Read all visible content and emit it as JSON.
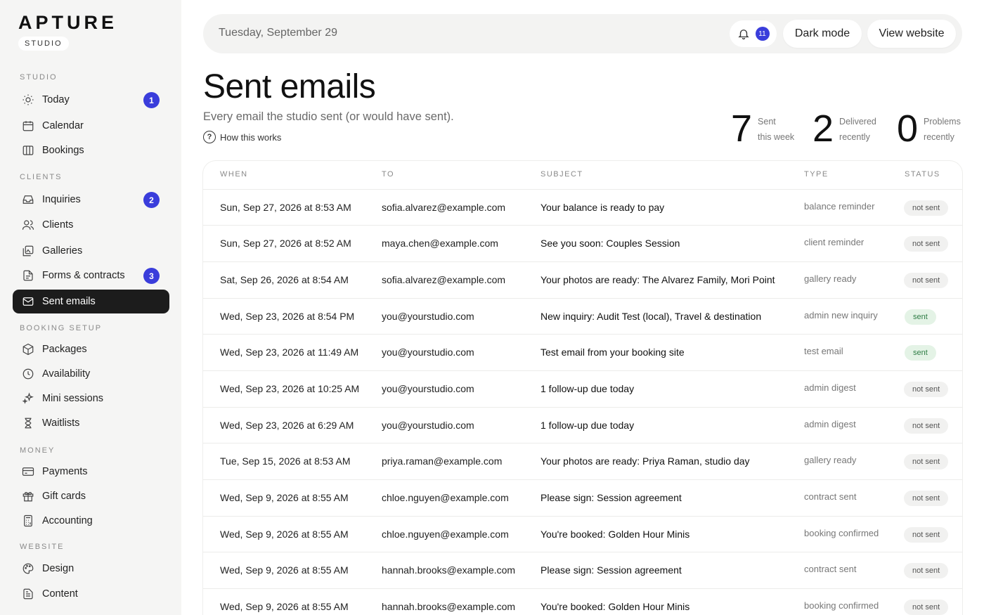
{
  "brand": {
    "wordmark": "APTURE",
    "badge": "STUDIO"
  },
  "sidebar": {
    "sections": [
      {
        "title": "STUDIO",
        "items": [
          {
            "label": "Today",
            "icon": "sun-icon",
            "badge": "1"
          },
          {
            "label": "Calendar",
            "icon": "calendar-icon"
          },
          {
            "label": "Bookings",
            "icon": "columns-icon"
          }
        ]
      },
      {
        "title": "CLIENTS",
        "items": [
          {
            "label": "Inquiries",
            "icon": "inbox-icon",
            "badge": "2"
          },
          {
            "label": "Clients",
            "icon": "users-icon"
          },
          {
            "label": "Galleries",
            "icon": "gallery-icon"
          },
          {
            "label": "Forms & contracts",
            "icon": "contract-icon",
            "badge": "3"
          },
          {
            "label": "Sent emails",
            "icon": "mail-icon",
            "active": true
          }
        ]
      },
      {
        "title": "BOOKING SETUP",
        "items": [
          {
            "label": "Packages",
            "icon": "package-icon"
          },
          {
            "label": "Availability",
            "icon": "clock-icon"
          },
          {
            "label": "Mini sessions",
            "icon": "sparkle-icon"
          },
          {
            "label": "Waitlists",
            "icon": "hourglass-icon"
          }
        ]
      },
      {
        "title": "MONEY",
        "items": [
          {
            "label": "Payments",
            "icon": "credit-card-icon"
          },
          {
            "label": "Gift cards",
            "icon": "gift-icon"
          },
          {
            "label": "Accounting",
            "icon": "calculator-icon"
          }
        ]
      },
      {
        "title": "WEBSITE",
        "items": [
          {
            "label": "Design",
            "icon": "palette-icon"
          },
          {
            "label": "Content",
            "icon": "document-icon"
          }
        ]
      }
    ]
  },
  "topbar": {
    "date": "Tuesday, September 29",
    "notifications_count": "11",
    "dark_mode_label": "Dark mode",
    "view_website_label": "View website"
  },
  "page": {
    "title": "Sent emails",
    "subtitle": "Every email the studio sent (or would have sent).",
    "how_link": "How this works"
  },
  "stats": [
    {
      "value": "7",
      "label_1": "Sent",
      "label_2": "this week"
    },
    {
      "value": "2",
      "label_1": "Delivered",
      "label_2": "recently"
    },
    {
      "value": "0",
      "label_1": "Problems",
      "label_2": "recently"
    }
  ],
  "table": {
    "headers": {
      "when": "WHEN",
      "to": "TO",
      "subject": "SUBJECT",
      "type": "TYPE",
      "status": "STATUS"
    },
    "rows": [
      {
        "when": "Sun, Sep 27, 2026 at 8:53 AM",
        "to": "sofia.alvarez@example.com",
        "subject": "Your balance is ready to pay",
        "type": "balance reminder",
        "status": "not sent"
      },
      {
        "when": "Sun, Sep 27, 2026 at 8:52 AM",
        "to": "maya.chen@example.com",
        "subject": "See you soon: Couples Session",
        "type": "client reminder",
        "status": "not sent"
      },
      {
        "when": "Sat, Sep 26, 2026 at 8:54 AM",
        "to": "sofia.alvarez@example.com",
        "subject": "Your photos are ready: The Alvarez Family, Mori Point",
        "type": "gallery ready",
        "status": "not sent"
      },
      {
        "when": "Wed, Sep 23, 2026 at 8:54 PM",
        "to": "you@yourstudio.com",
        "subject": "New inquiry: Audit Test (local), Travel & destination",
        "type": "admin new inquiry",
        "status": "sent"
      },
      {
        "when": "Wed, Sep 23, 2026 at 11:49 AM",
        "to": "you@yourstudio.com",
        "subject": "Test email from your booking site",
        "type": "test email",
        "status": "sent"
      },
      {
        "when": "Wed, Sep 23, 2026 at 10:25 AM",
        "to": "you@yourstudio.com",
        "subject": "1 follow-up due today",
        "type": "admin digest",
        "status": "not sent"
      },
      {
        "when": "Wed, Sep 23, 2026 at 6:29 AM",
        "to": "you@yourstudio.com",
        "subject": "1 follow-up due today",
        "type": "admin digest",
        "status": "not sent"
      },
      {
        "when": "Tue, Sep 15, 2026 at 8:53 AM",
        "to": "priya.raman@example.com",
        "subject": "Your photos are ready: Priya Raman, studio day",
        "type": "gallery ready",
        "status": "not sent"
      },
      {
        "when": "Wed, Sep 9, 2026 at 8:55 AM",
        "to": "chloe.nguyen@example.com",
        "subject": "Please sign: Session agreement",
        "type": "contract sent",
        "status": "not sent"
      },
      {
        "when": "Wed, Sep 9, 2026 at 8:55 AM",
        "to": "chloe.nguyen@example.com",
        "subject": "You're booked: Golden Hour Minis",
        "type": "booking confirmed",
        "status": "not sent"
      },
      {
        "when": "Wed, Sep 9, 2026 at 8:55 AM",
        "to": "hannah.brooks@example.com",
        "subject": "Please sign: Session agreement",
        "type": "contract sent",
        "status": "not sent"
      },
      {
        "when": "Wed, Sep 9, 2026 at 8:55 AM",
        "to": "hannah.brooks@example.com",
        "subject": "You're booked: Golden Hour Minis",
        "type": "booking confirmed",
        "status": "not sent"
      }
    ]
  },
  "colors": {
    "accent": "#3a3ddb",
    "active_nav": "#1c1c1c",
    "sent_green": "#2e7d45"
  }
}
